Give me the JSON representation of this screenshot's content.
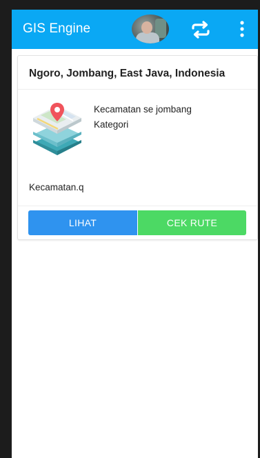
{
  "appbar": {
    "title": "GIS Engine",
    "background_color": "#0AA8F4",
    "icons": [
      "avatar",
      "swap-icon",
      "more-vert-icon"
    ]
  },
  "card": {
    "title": "Ngoro, Jombang, East Java, Indonesia",
    "icon": "map-layers-icon",
    "name": "Kecamatan se jombang",
    "category": "Kategori",
    "file": "Kecamatan.q",
    "buttons": {
      "lihat": "LIHAT",
      "cek_rute": "CEK RUTE"
    },
    "colors": {
      "lihat": "#2F93EF",
      "cek_rute": "#4CD964"
    }
  }
}
